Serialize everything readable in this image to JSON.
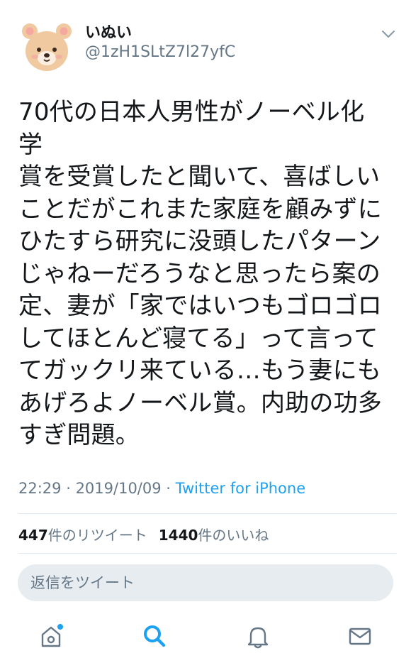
{
  "user": {
    "display_name": "いぬい",
    "handle": "@1zH1SLtZ7l27yfC",
    "avatar_icon": "bear-avatar-icon"
  },
  "menu": {
    "icon": "chevron-down-icon"
  },
  "tweet": {
    "text": "70代の日本人男性がノーベル化学\n賞を受賞したと聞いて、喜ばしい\nことだがこれまた家庭を顧みずに\nひたすら研究に没頭したパターン\nじゃねーだろうなと思ったら案の\n定、妻が「家ではいつもゴロゴロ\nしてほとんど寝てる」って言って\nてガックリ来ている…もう妻にも\nあげろよノーベル賞。内助の功多\nすぎ問題。"
  },
  "meta": {
    "time": "22:29",
    "separator1": " · ",
    "date": "2019/10/09",
    "separator2": " · ",
    "source": "Twitter for iPhone"
  },
  "stats": {
    "retweet_count": "447",
    "retweet_label": "件のリツイート",
    "like_count": "1440",
    "like_label": "件のいいね"
  },
  "reply": {
    "placeholder": "返信をツイート"
  },
  "tabbar": {
    "items": [
      {
        "icon": "home-icon",
        "active": false,
        "notification_dot": true
      },
      {
        "icon": "search-icon",
        "active": true,
        "notification_dot": false
      },
      {
        "icon": "bell-icon",
        "active": false,
        "notification_dot": false
      },
      {
        "icon": "mail-icon",
        "active": false,
        "notification_dot": false
      }
    ]
  },
  "colors": {
    "accent": "#1da1f2",
    "text": "#14171a",
    "secondary": "#657786",
    "divider": "#e1e8ed",
    "reply_bg": "#e6ecf0",
    "avatar_fur": "#f0c9a0"
  }
}
